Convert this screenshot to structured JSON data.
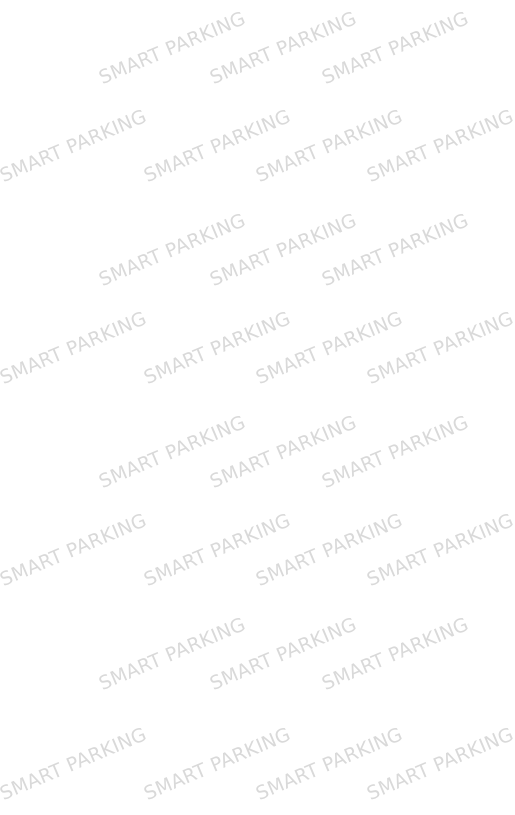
{
  "watermark": {
    "text": "SMART PARKING",
    "color": "#d9d9d9"
  },
  "background_color": "#ffffff"
}
